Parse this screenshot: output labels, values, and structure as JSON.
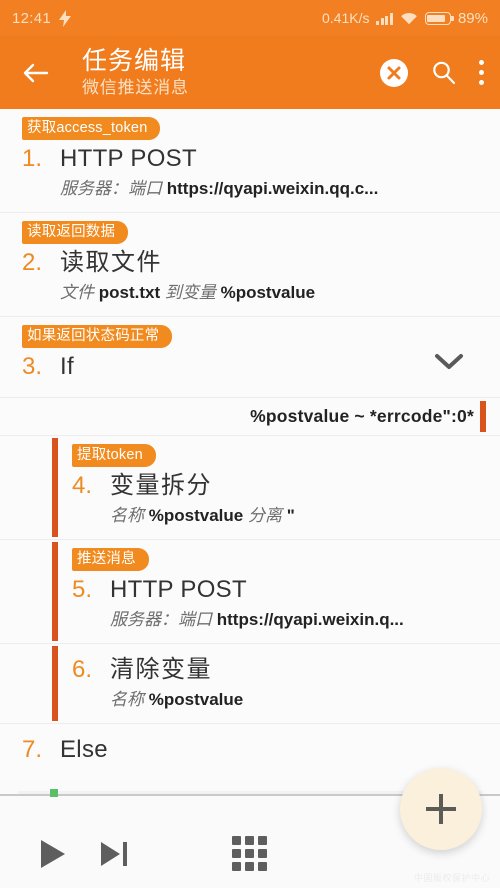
{
  "status_bar": {
    "time": "12:41",
    "charging_icon": "lightning-bolt-icon",
    "network_speed": "0.41K/s",
    "signal_icon": "signal-bars-icon",
    "wifi_icon": "wifi-icon",
    "battery_icon": "battery-icon",
    "battery_percent": "89%",
    "background_color": "#F28022"
  },
  "toolbar": {
    "back_icon": "back-arrow-icon",
    "title": "任务编辑",
    "subtitle": "微信推送消息",
    "close_icon": "close-circle-icon",
    "search_icon": "search-icon",
    "overflow_icon": "overflow-menu-icon",
    "background_color": "#F07C1E"
  },
  "steps": [
    {
      "number": "1.",
      "tag": "获取access_token",
      "title": "HTTP POST",
      "detail": [
        {
          "text": "服务器：端口",
          "style": "label"
        },
        {
          "text": "https://qyapi.weixin.qq.c...",
          "style": "value"
        }
      ],
      "indented": false
    },
    {
      "number": "2.",
      "tag": "读取返回数据",
      "title": "读取文件",
      "detail": [
        {
          "text": "文件",
          "style": "label"
        },
        {
          "text": "post.txt",
          "style": "value"
        },
        {
          "text": "到变量",
          "style": "label"
        },
        {
          "text": "%postvalue",
          "style": "value"
        }
      ],
      "indented": false
    },
    {
      "number": "3.",
      "tag": "如果返回状态码正常",
      "title": "If",
      "detail": [],
      "indented": false,
      "expand_icon": "chevron-down-icon",
      "condition": "%postvalue ~ *errcode\":0*"
    },
    {
      "number": "4.",
      "tag": "提取token",
      "title": "变量拆分",
      "detail": [
        {
          "text": "名称",
          "style": "label"
        },
        {
          "text": "%postvalue",
          "style": "value"
        },
        {
          "text": "分离",
          "style": "label"
        },
        {
          "text": "\"",
          "style": "value"
        }
      ],
      "indented": true
    },
    {
      "number": "5.",
      "tag": "推送消息",
      "title": "HTTP POST",
      "detail": [
        {
          "text": "服务器：端口",
          "style": "label"
        },
        {
          "text": "https://qyapi.weixin.q...",
          "style": "value"
        }
      ],
      "indented": true
    },
    {
      "number": "6.",
      "tag": "",
      "title": "清除变量",
      "detail": [
        {
          "text": "名称",
          "style": "label"
        },
        {
          "text": "%postvalue",
          "style": "value"
        }
      ],
      "indented": true
    },
    {
      "number": "7.",
      "tag": "",
      "title": "Else",
      "detail": [],
      "indented": false
    }
  ],
  "bottom_bar": {
    "run_icon": "play-icon",
    "step_icon": "step-forward-icon",
    "grid_icon": "grid-apps-icon",
    "add_icon": "plus-icon",
    "progress_marker": "scroll-position-marker",
    "fab_color": "#FBF0DC"
  },
  "watermark": "中国版权保护中心"
}
